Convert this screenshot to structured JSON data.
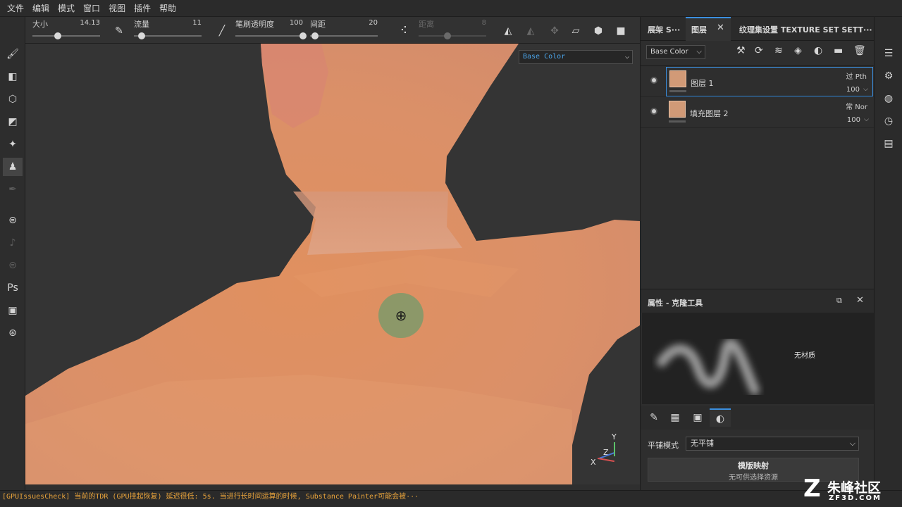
{
  "menu": [
    "文件",
    "编辑",
    "模式",
    "窗口",
    "视图",
    "插件",
    "帮助"
  ],
  "toolbar": {
    "size_label": "大小",
    "size_value": "14.13",
    "flow_label": "流量",
    "flow_value": "11",
    "opacity_label": "笔刷透明度",
    "opacity_value": "100",
    "spacing_label": "间距",
    "spacing_value": "20",
    "distance_label": "距离",
    "distance_value": "8",
    "size_fraction": 0.37,
    "flow_fraction": 0.11,
    "opacity_fraction": 1.0,
    "spacing_fraction": 0.07
  },
  "viewport": {
    "channel": "Base Color",
    "axis_y": "Y",
    "axis_z": "Z",
    "axis_x": "X"
  },
  "panel_tabs": {
    "shelf": "展架 S···",
    "layers": "图层",
    "texture_set": "纹理集设置 TEXTURE SET SETT···"
  },
  "layers_toolbar": {
    "channel": "Base Color"
  },
  "layers": [
    {
      "name": "图层 1",
      "blend": "过 Pth",
      "opacity": "100",
      "selected": true
    },
    {
      "name": "填充图层 2",
      "blend": "常 Nor",
      "opacity": "100",
      "selected": false
    }
  ],
  "properties": {
    "title": "属性 - 克隆工具",
    "no_material": "无材质",
    "tiling_label": "平铺模式",
    "tiling_value": "无平铺",
    "stencil_title": "模版映射",
    "stencil_sub": "无可供选择资源"
  },
  "status": {
    "message": "[GPUIssuesCheck] 当前的TDR (GPU挂起恢复) 延迟很低: 5s. 当进行长时间运算的时候, Substance Painter可能会被···"
  },
  "watermark": {
    "main": "朱峰社区",
    "sub": "ZF3D.COM"
  },
  "colors": {
    "accent": "#3b8fe0",
    "skin": "#d9916a",
    "status_warning": "#e8a33b"
  }
}
